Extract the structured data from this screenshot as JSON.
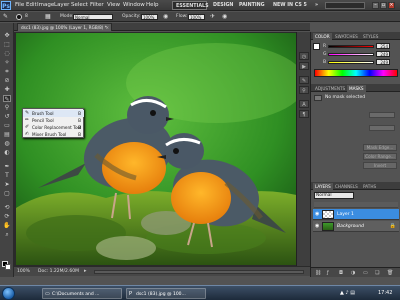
{
  "menubar": {
    "logo": "Ps",
    "items": [
      "File",
      "Edit",
      "Image",
      "Layer",
      "Select",
      "Filter",
      "View",
      "Window",
      "Help"
    ],
    "workspaces": [
      "ESSENTIALS",
      "DESIGN",
      "PAINTING",
      "NEW IN CS 5"
    ],
    "more": "»"
  },
  "options": {
    "brush_size": "8",
    "mode_label": "Mode:",
    "mode_value": "Normal",
    "opacity_label": "Opacity:",
    "opacity_value": "100%",
    "flow_label": "Flow:",
    "flow_value": "100%"
  },
  "document": {
    "tab_title": "dsc1 (83).jpg @ 100% (Layer 1, RGB/8) *",
    "zoom": "100%",
    "doc_info": "Doc: 1.22M/2.60M"
  },
  "flyout": {
    "items": [
      {
        "label": "Brush Tool",
        "key": "B"
      },
      {
        "label": "Pencil Tool",
        "key": "B"
      },
      {
        "label": "Color Replacement Tool",
        "key": "B"
      },
      {
        "label": "Mixer Brush Tool",
        "key": "B"
      }
    ]
  },
  "panels": {
    "color_tabs": [
      "COLOR",
      "SWATCHES",
      "STYLES"
    ],
    "color_values": {
      "r": "254",
      "g": "249",
      "b": "249"
    },
    "channel_labels": [
      "R",
      "G",
      "B"
    ],
    "adj_tabs": [
      "ADJUSTMENTS",
      "MASKS"
    ],
    "no_mask": "No mask selected",
    "adj_buttons": [
      "Mask Edge...",
      "Color Range...",
      "Invert"
    ],
    "layer_tabs": [
      "LAYERS",
      "CHANNELS",
      "PATHS"
    ],
    "blend_mode": "Normal",
    "layers": [
      "Layer 1",
      "Background"
    ]
  },
  "taskbar": {
    "items": [
      "C:\\Documents and ...",
      "dsc1 (83).jpg @ 100..."
    ],
    "clock": "17:42"
  },
  "colors": {
    "accent": "#3b8de0",
    "fg": "#000000",
    "bg": "#ffffff"
  }
}
